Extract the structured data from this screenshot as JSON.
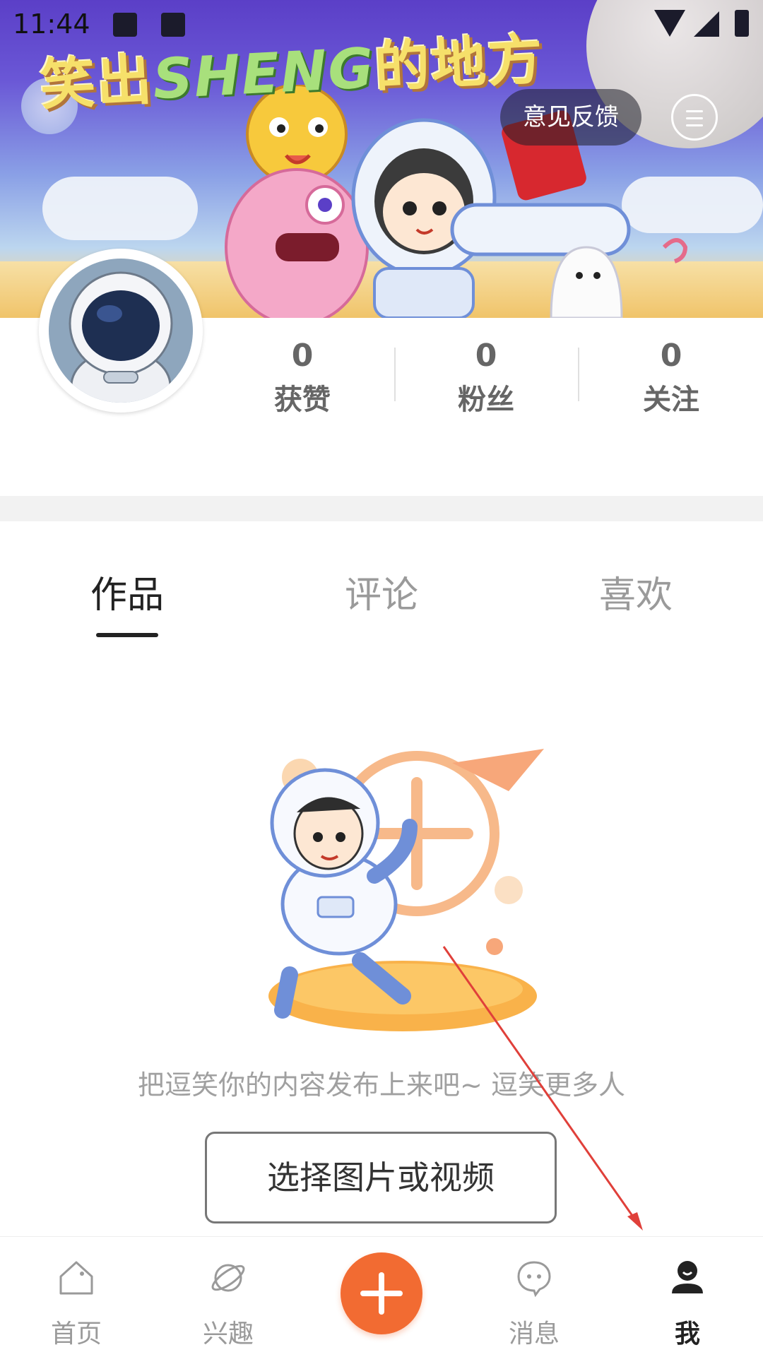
{
  "status_bar": {
    "time": "11:44"
  },
  "banner": {
    "title_part1": "笑出",
    "title_part2": "SHENG",
    "title_part3": "的地方"
  },
  "header": {
    "feedback_label": "意见反馈"
  },
  "stats": [
    {
      "count": "0",
      "label": "获赞"
    },
    {
      "count": "0",
      "label": "粉丝"
    },
    {
      "count": "0",
      "label": "关注"
    }
  ],
  "tabs": [
    {
      "label": "作品"
    },
    {
      "label": "评论"
    },
    {
      "label": "喜欢"
    }
  ],
  "empty_state": {
    "text": "把逗笑你的内容发布上来吧~ 逗笑更多人",
    "button_label": "选择图片或视频"
  },
  "bottom_nav": [
    {
      "label": "首页",
      "icon": "home-icon"
    },
    {
      "label": "兴趣",
      "icon": "planet-icon"
    },
    {
      "label": "",
      "icon": "plus-icon"
    },
    {
      "label": "消息",
      "icon": "message-icon"
    },
    {
      "label": "我",
      "icon": "user-icon"
    }
  ],
  "colors": {
    "accent": "#f26b32",
    "active_tab": "#222222",
    "inactive": "#9a9a9a"
  }
}
